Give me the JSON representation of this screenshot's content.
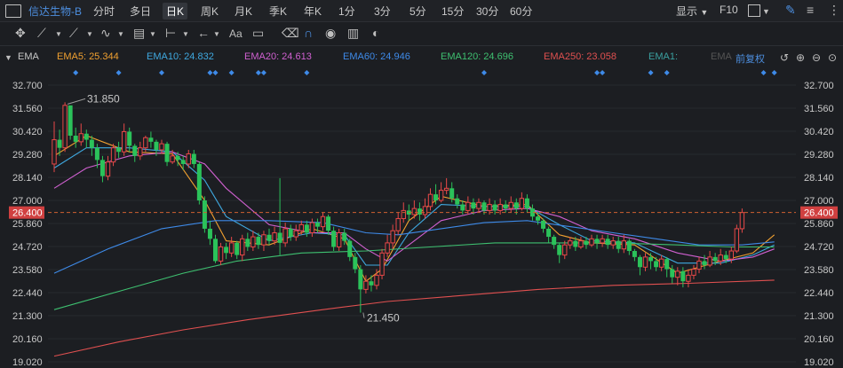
{
  "toolbar": {
    "stock_title": "信达生物-B",
    "periods": [
      "分时",
      "多日",
      "日K",
      "周K",
      "月K",
      "季K",
      "年K",
      "1分",
      "3分",
      "5分",
      "15分",
      "30分",
      "60分"
    ],
    "active_period": "日K",
    "display_label": "显示",
    "f10_label": "F10"
  },
  "drawing_tools": {
    "text_tool": "Aa"
  },
  "indicator_bar": {
    "name": "EMA",
    "items": [
      {
        "label": "EMA5: 25.344",
        "color": "#f0a030"
      },
      {
        "label": "EMA10: 24.832",
        "color": "#3fa9e0"
      },
      {
        "label": "EMA20: 24.613",
        "color": "#d060d0"
      },
      {
        "label": "EMA60: 24.946",
        "color": "#3e8ae8"
      },
      {
        "label": "EMA120: 24.696",
        "color": "#3ec070"
      },
      {
        "label": "EMA250: 23.058",
        "color": "#e05050"
      },
      {
        "label": "EMA1:",
        "color": "#3aa0a0"
      },
      {
        "label": "EMA",
        "color": "#555555"
      }
    ],
    "adjust_label": "前复权"
  },
  "chart_data": {
    "type": "candlestick",
    "y_ticks": [
      "32.700",
      "31.560",
      "30.420",
      "29.280",
      "28.140",
      "27.000",
      "25.860",
      "24.720",
      "23.580",
      "22.440",
      "21.300",
      "20.160",
      "19.020"
    ],
    "ylim": [
      19.02,
      32.7
    ],
    "current_price": "26.400",
    "max_label": "31.850",
    "min_label": "21.450",
    "candles": [
      [
        28.8,
        30.0,
        30.9,
        28.4
      ],
      [
        30.0,
        29.6,
        30.5,
        29.2
      ],
      [
        29.6,
        31.7,
        31.85,
        29.4
      ],
      [
        31.7,
        30.2,
        31.6,
        30.0
      ],
      [
        30.2,
        29.9,
        30.6,
        29.6
      ],
      [
        29.9,
        30.3,
        30.8,
        29.7
      ],
      [
        30.3,
        30.0,
        30.5,
        29.6
      ],
      [
        30.0,
        29.6,
        30.2,
        29.2
      ],
      [
        29.6,
        29.0,
        29.8,
        28.6
      ],
      [
        29.0,
        28.2,
        29.2,
        27.9
      ],
      [
        28.2,
        28.9,
        29.2,
        28.0
      ],
      [
        28.9,
        29.6,
        29.8,
        28.7
      ],
      [
        29.6,
        29.4,
        29.9,
        29.1
      ],
      [
        29.4,
        30.4,
        30.8,
        29.2
      ],
      [
        30.4,
        29.7,
        30.6,
        29.4
      ],
      [
        29.7,
        29.2,
        29.8,
        28.9
      ],
      [
        29.2,
        29.6,
        29.9,
        29.0
      ],
      [
        29.6,
        30.1,
        30.2,
        29.4
      ],
      [
        30.1,
        29.9,
        30.4,
        29.6
      ],
      [
        29.9,
        29.5,
        30.0,
        29.2
      ],
      [
        29.5,
        29.8,
        30.0,
        29.3
      ],
      [
        29.8,
        28.9,
        29.9,
        28.7
      ],
      [
        28.9,
        29.2,
        29.5,
        28.8
      ],
      [
        29.2,
        29.0,
        29.4,
        28.7
      ],
      [
        29.0,
        28.8,
        29.2,
        28.5
      ],
      [
        28.8,
        29.3,
        29.5,
        28.6
      ],
      [
        29.3,
        28.8,
        29.5,
        28.6
      ],
      [
        28.8,
        27.0,
        28.9,
        26.8
      ],
      [
        27.0,
        25.6,
        27.2,
        25.4
      ],
      [
        25.6,
        25.1,
        26.0,
        24.8
      ],
      [
        25.1,
        24.0,
        25.3,
        23.9
      ],
      [
        24.0,
        24.7,
        24.9,
        23.8
      ],
      [
        24.7,
        24.4,
        24.9,
        24.1
      ],
      [
        24.4,
        24.9,
        25.2,
        24.2
      ],
      [
        24.9,
        24.3,
        25.0,
        24.1
      ],
      [
        24.3,
        25.1,
        25.3,
        24.0
      ],
      [
        25.1,
        24.7,
        25.4,
        24.5
      ],
      [
        24.7,
        25.2,
        25.5,
        24.5
      ],
      [
        25.2,
        24.8,
        25.4,
        24.6
      ],
      [
        24.8,
        25.3,
        25.5,
        24.5
      ],
      [
        25.3,
        25.0,
        25.6,
        24.8
      ],
      [
        25.0,
        25.4,
        25.7,
        24.8
      ],
      [
        25.4,
        24.9,
        28.1,
        24.3
      ],
      [
        24.9,
        25.6,
        25.9,
        24.7
      ],
      [
        25.6,
        25.2,
        25.8,
        25.0
      ],
      [
        25.2,
        25.5,
        25.8,
        25.0
      ],
      [
        25.5,
        25.8,
        26.0,
        25.3
      ],
      [
        25.8,
        25.4,
        26.0,
        25.2
      ],
      [
        25.4,
        25.9,
        26.1,
        25.2
      ],
      [
        25.9,
        25.7,
        26.1,
        25.4
      ],
      [
        25.7,
        26.2,
        26.4,
        25.5
      ],
      [
        26.2,
        25.5,
        26.3,
        25.3
      ],
      [
        25.5,
        24.7,
        25.7,
        24.5
      ],
      [
        24.7,
        25.4,
        25.6,
        24.5
      ],
      [
        25.4,
        25.0,
        25.6,
        24.8
      ],
      [
        25.0,
        24.2,
        25.1,
        24.0
      ],
      [
        24.2,
        23.6,
        24.4,
        23.4
      ],
      [
        23.6,
        22.6,
        23.8,
        21.45
      ],
      [
        22.6,
        23.0,
        23.3,
        22.4
      ],
      [
        23.0,
        22.8,
        23.3,
        22.5
      ],
      [
        22.8,
        23.3,
        23.6,
        22.6
      ],
      [
        23.3,
        24.4,
        24.6,
        23.1
      ],
      [
        24.4,
        24.9,
        25.3,
        24.2
      ],
      [
        24.9,
        25.5,
        25.8,
        24.6
      ],
      [
        25.5,
        26.1,
        26.4,
        25.3
      ],
      [
        26.1,
        26.5,
        26.9,
        25.9
      ],
      [
        26.5,
        26.3,
        26.8,
        26.0
      ],
      [
        26.3,
        26.6,
        27.0,
        26.1
      ],
      [
        26.6,
        26.3,
        26.9,
        26.0
      ],
      [
        26.3,
        26.7,
        27.1,
        26.1
      ],
      [
        26.7,
        27.3,
        27.6,
        26.5
      ],
      [
        27.3,
        27.0,
        27.8,
        26.8
      ],
      [
        27.0,
        27.5,
        27.9,
        26.9
      ],
      [
        27.5,
        27.6,
        28.1,
        27.3
      ],
      [
        27.6,
        27.1,
        27.9,
        26.9
      ],
      [
        27.1,
        26.8,
        27.3,
        26.6
      ],
      [
        26.8,
        26.5,
        27.0,
        26.3
      ],
      [
        26.5,
        26.9,
        27.2,
        26.3
      ],
      [
        26.9,
        26.6,
        27.1,
        26.3
      ],
      [
        26.6,
        26.9,
        27.1,
        26.4
      ],
      [
        26.9,
        26.5,
        27.0,
        26.3
      ],
      [
        26.5,
        26.8,
        27.1,
        26.3
      ],
      [
        26.8,
        26.5,
        27.0,
        26.3
      ],
      [
        26.5,
        26.8,
        27.1,
        26.3
      ],
      [
        26.8,
        26.6,
        27.0,
        26.4
      ],
      [
        26.6,
        26.9,
        27.2,
        26.4
      ],
      [
        26.9,
        26.6,
        27.1,
        26.3
      ],
      [
        26.6,
        27.1,
        27.4,
        26.5
      ],
      [
        27.1,
        26.6,
        27.3,
        26.4
      ],
      [
        26.6,
        26.2,
        26.8,
        26.0
      ],
      [
        26.2,
        26.0,
        26.4,
        25.8
      ],
      [
        26.0,
        25.6,
        26.1,
        25.4
      ],
      [
        25.6,
        25.2,
        25.7,
        24.9
      ],
      [
        25.2,
        24.8,
        25.3,
        24.6
      ],
      [
        24.8,
        24.3,
        24.9,
        23.9
      ],
      [
        24.3,
        24.8,
        25.0,
        24.1
      ],
      [
        24.8,
        25.0,
        25.2,
        24.6
      ],
      [
        25.0,
        24.7,
        25.2,
        24.5
      ],
      [
        24.7,
        25.0,
        25.2,
        24.6
      ],
      [
        25.0,
        24.8,
        25.2,
        24.6
      ],
      [
        24.8,
        25.1,
        25.3,
        24.7
      ],
      [
        25.1,
        24.9,
        25.3,
        24.6
      ],
      [
        24.9,
        25.1,
        25.3,
        24.7
      ],
      [
        25.1,
        24.8,
        25.3,
        24.6
      ],
      [
        24.8,
        25.0,
        25.2,
        24.6
      ],
      [
        25.0,
        24.6,
        25.2,
        24.4
      ],
      [
        24.6,
        25.0,
        25.3,
        24.4
      ],
      [
        25.0,
        24.5,
        25.1,
        24.3
      ],
      [
        24.5,
        24.2,
        24.6,
        24.0
      ],
      [
        24.2,
        23.7,
        24.3,
        23.3
      ],
      [
        23.7,
        24.2,
        24.4,
        23.5
      ],
      [
        24.2,
        24.0,
        24.4,
        23.6
      ],
      [
        24.0,
        23.7,
        24.2,
        23.5
      ],
      [
        23.7,
        24.1,
        24.3,
        23.5
      ],
      [
        24.1,
        23.6,
        24.2,
        23.2
      ],
      [
        23.6,
        23.2,
        23.8,
        22.9
      ],
      [
        23.2,
        23.5,
        23.7,
        22.8
      ],
      [
        23.5,
        23.0,
        23.7,
        22.7
      ],
      [
        23.0,
        23.3,
        23.6,
        22.7
      ],
      [
        23.3,
        23.6,
        23.8,
        23.1
      ],
      [
        23.6,
        24.0,
        24.2,
        23.4
      ],
      [
        24.0,
        23.8,
        24.3,
        23.6
      ],
      [
        23.8,
        24.2,
        24.5,
        23.7
      ],
      [
        24.2,
        24.0,
        24.4,
        23.8
      ],
      [
        24.0,
        24.3,
        24.6,
        23.8
      ],
      [
        24.3,
        24.1,
        24.5,
        23.9
      ],
      [
        24.1,
        24.5,
        24.7,
        23.9
      ],
      [
        24.5,
        25.6,
        25.8,
        24.4
      ],
      [
        25.6,
        26.4,
        26.6,
        25.4
      ]
    ],
    "ema_lines": [
      {
        "name": "EMA5",
        "color": "#f0a030",
        "points": [
          [
            0,
            29.2
          ],
          [
            6,
            30.2
          ],
          [
            14,
            29.4
          ],
          [
            22,
            29.3
          ],
          [
            28,
            27.0
          ],
          [
            32,
            25.0
          ],
          [
            40,
            24.8
          ],
          [
            48,
            25.6
          ],
          [
            54,
            25.1
          ],
          [
            58,
            23.0
          ],
          [
            61,
            23.6
          ],
          [
            66,
            26.0
          ],
          [
            72,
            27.2
          ],
          [
            80,
            26.7
          ],
          [
            88,
            26.8
          ],
          [
            94,
            25.3
          ],
          [
            100,
            24.9
          ],
          [
            108,
            24.8
          ],
          [
            116,
            23.4
          ],
          [
            124,
            24.0
          ],
          [
            130,
            24.4
          ],
          [
            134,
            25.3
          ]
        ]
      },
      {
        "name": "EMA10",
        "color": "#3fa9e0",
        "points": [
          [
            0,
            28.6
          ],
          [
            6,
            29.6
          ],
          [
            14,
            29.6
          ],
          [
            22,
            29.4
          ],
          [
            28,
            28.0
          ],
          [
            32,
            26.2
          ],
          [
            40,
            25.0
          ],
          [
            48,
            25.4
          ],
          [
            54,
            25.3
          ],
          [
            58,
            23.8
          ],
          [
            62,
            23.8
          ],
          [
            66,
            25.4
          ],
          [
            72,
            26.8
          ],
          [
            80,
            26.7
          ],
          [
            88,
            26.7
          ],
          [
            94,
            25.8
          ],
          [
            100,
            25.0
          ],
          [
            108,
            24.9
          ],
          [
            116,
            23.9
          ],
          [
            124,
            23.9
          ],
          [
            130,
            24.3
          ],
          [
            134,
            24.8
          ]
        ]
      },
      {
        "name": "EMA20",
        "color": "#d060d0",
        "points": [
          [
            0,
            27.6
          ],
          [
            6,
            28.6
          ],
          [
            14,
            29.2
          ],
          [
            22,
            29.4
          ],
          [
            28,
            28.8
          ],
          [
            32,
            27.6
          ],
          [
            40,
            25.8
          ],
          [
            48,
            25.4
          ],
          [
            54,
            25.4
          ],
          [
            58,
            24.6
          ],
          [
            62,
            24.0
          ],
          [
            66,
            24.8
          ],
          [
            72,
            26.0
          ],
          [
            80,
            26.5
          ],
          [
            88,
            26.6
          ],
          [
            94,
            26.2
          ],
          [
            100,
            25.5
          ],
          [
            108,
            25.1
          ],
          [
            116,
            24.4
          ],
          [
            124,
            24.0
          ],
          [
            130,
            24.2
          ],
          [
            134,
            24.6
          ]
        ]
      },
      {
        "name": "EMA60",
        "color": "#3e8ae8",
        "points": [
          [
            0,
            23.4
          ],
          [
            10,
            24.6
          ],
          [
            20,
            25.6
          ],
          [
            30,
            26.0
          ],
          [
            40,
            26.0
          ],
          [
            50,
            25.9
          ],
          [
            58,
            25.4
          ],
          [
            64,
            25.3
          ],
          [
            72,
            25.6
          ],
          [
            80,
            25.9
          ],
          [
            88,
            26.0
          ],
          [
            96,
            25.7
          ],
          [
            104,
            25.4
          ],
          [
            112,
            25.1
          ],
          [
            120,
            24.8
          ],
          [
            128,
            24.8
          ],
          [
            134,
            24.95
          ]
        ]
      },
      {
        "name": "EMA120",
        "color": "#3ec070",
        "points": [
          [
            0,
            21.6
          ],
          [
            12,
            22.5
          ],
          [
            24,
            23.4
          ],
          [
            34,
            24.0
          ],
          [
            46,
            24.4
          ],
          [
            58,
            24.5
          ],
          [
            70,
            24.7
          ],
          [
            82,
            24.9
          ],
          [
            94,
            24.9
          ],
          [
            104,
            24.9
          ],
          [
            116,
            24.8
          ],
          [
            126,
            24.7
          ],
          [
            134,
            24.7
          ]
        ]
      },
      {
        "name": "EMA250",
        "color": "#e05050",
        "points": [
          [
            0,
            19.3
          ],
          [
            12,
            20.0
          ],
          [
            24,
            20.6
          ],
          [
            36,
            21.1
          ],
          [
            50,
            21.6
          ],
          [
            62,
            22.0
          ],
          [
            76,
            22.3
          ],
          [
            90,
            22.6
          ],
          [
            104,
            22.8
          ],
          [
            118,
            22.9
          ],
          [
            134,
            23.06
          ]
        ]
      }
    ]
  }
}
